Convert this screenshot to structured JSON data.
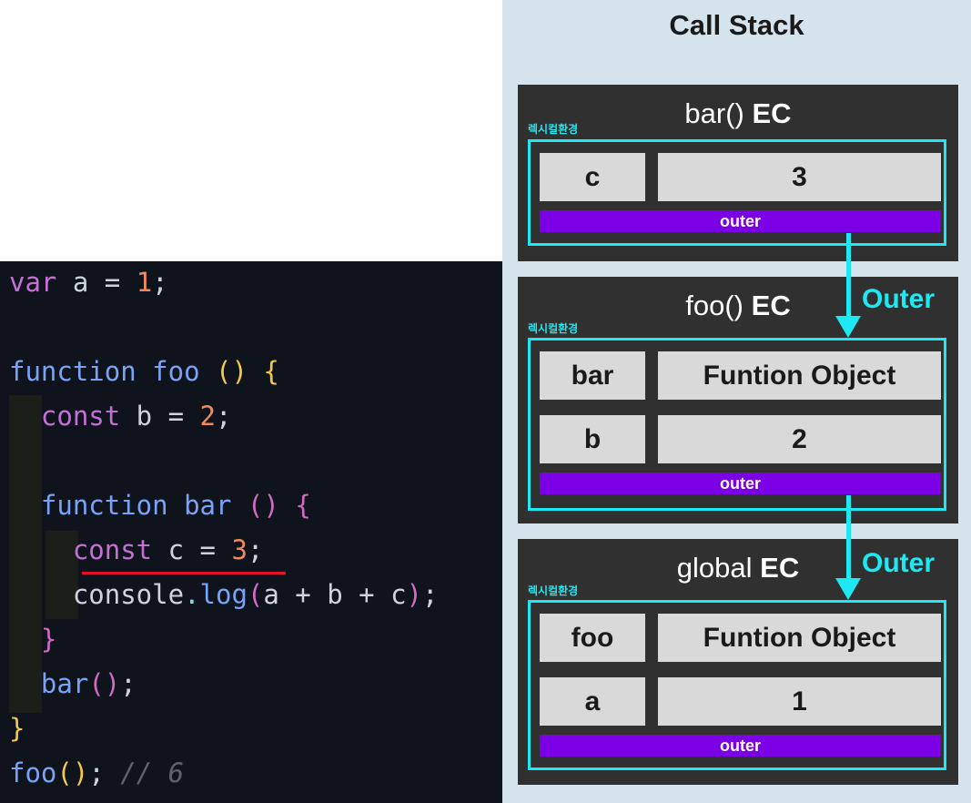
{
  "code": {
    "lines": [
      [
        {
          "t": "var",
          "c": "k-var"
        },
        {
          "t": " a = ",
          "c": "k-id"
        },
        {
          "t": "1",
          "c": "k-num"
        },
        {
          "t": ";",
          "c": "k-semi"
        }
      ],
      [],
      [
        {
          "t": "function",
          "c": "k-fn"
        },
        {
          "t": " foo ",
          "c": "k-name"
        },
        {
          "t": "()",
          "c": "k-brace-y"
        },
        {
          "t": " ",
          "c": "k-id"
        },
        {
          "t": "{",
          "c": "k-brace-y"
        }
      ],
      [
        {
          "t": "  const",
          "c": "k-var"
        },
        {
          "t": " b = ",
          "c": "k-id"
        },
        {
          "t": "2",
          "c": "k-num"
        },
        {
          "t": ";",
          "c": "k-semi"
        }
      ],
      [],
      [
        {
          "t": "  function",
          "c": "k-fn"
        },
        {
          "t": " bar ",
          "c": "k-name"
        },
        {
          "t": "()",
          "c": "k-brace-m"
        },
        {
          "t": " ",
          "c": "k-id"
        },
        {
          "t": "{",
          "c": "k-brace-m"
        }
      ],
      [
        {
          "t": "    const",
          "c": "k-var"
        },
        {
          "t": " c = ",
          "c": "k-id"
        },
        {
          "t": "3",
          "c": "k-num"
        },
        {
          "t": ";",
          "c": "k-semi"
        }
      ],
      [
        {
          "t": "    console",
          "c": "k-id"
        },
        {
          "t": ".",
          "c": "k-op"
        },
        {
          "t": "log",
          "c": "k-name"
        },
        {
          "t": "(",
          "c": "k-brace-m"
        },
        {
          "t": "a + b + c",
          "c": "k-id"
        },
        {
          "t": ")",
          "c": "k-brace-m"
        },
        {
          "t": ";",
          "c": "k-semi"
        }
      ],
      [
        {
          "t": "  }",
          "c": "k-brace-m"
        }
      ],
      [
        {
          "t": "  bar",
          "c": "k-name"
        },
        {
          "t": "()",
          "c": "k-brace-m"
        },
        {
          "t": ";",
          "c": "k-semi"
        }
      ],
      [
        {
          "t": "}",
          "c": "k-brace-y"
        }
      ],
      [
        {
          "t": "foo",
          "c": "k-name"
        },
        {
          "t": "()",
          "c": "k-brace-y"
        },
        {
          "t": ";",
          "c": "k-semi"
        },
        {
          "t": " // 6",
          "c": "k-comment"
        }
      ]
    ]
  },
  "stack": {
    "title": "Call Stack",
    "lex_label": "렉시컬환경",
    "outer_label": "outer",
    "arrow_label": "Outer",
    "contexts": [
      {
        "name": "bar()",
        "suffix": "EC",
        "rows": [
          {
            "key": "c",
            "value": "3"
          }
        ]
      },
      {
        "name": "foo()",
        "suffix": "EC",
        "rows": [
          {
            "key": "bar",
            "value": "Funtion Object"
          },
          {
            "key": "b",
            "value": "2"
          }
        ]
      },
      {
        "name": "global",
        "suffix": "EC",
        "rows": [
          {
            "key": "foo",
            "value": "Funtion Object"
          },
          {
            "key": "a",
            "value": "1"
          }
        ]
      }
    ]
  },
  "colors": {
    "accent_cyan": "#1ee8f2",
    "outer_purple": "#7b00e6",
    "ec_box": "#303030",
    "panel_bg": "#d5e3ec",
    "code_bg": "#0f141c"
  }
}
